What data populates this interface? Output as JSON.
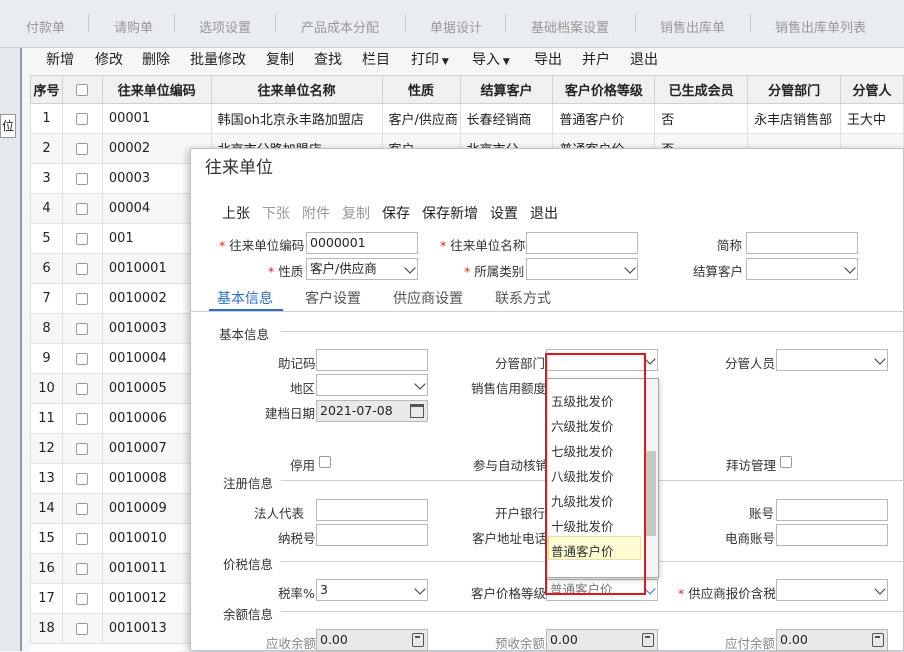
{
  "top_tabs": [
    "付款单",
    "请购单",
    "选项设置",
    "产品成本分配",
    "单据设计",
    "基础档案设置",
    "销售出库单",
    "销售出库单列表"
  ],
  "left_strip": {
    "label": "位"
  },
  "toolbar": [
    "新增",
    "修改",
    "删除",
    "批量修改",
    "复制",
    "查找",
    "栏目",
    "打印",
    "导入",
    "导出",
    "并户",
    "退出"
  ],
  "grid": {
    "columns": [
      "序号",
      "",
      "往来单位编码",
      "往来单位名称",
      "性质",
      "结算客户",
      "客户价格等级",
      "已生成会员",
      "分管部门",
      "分管人"
    ],
    "rows": [
      [
        "1",
        "",
        "00001",
        "韩国oh北京永丰路加盟店",
        "客户/供应商",
        "长春经销商",
        "普通客户价",
        "否",
        "永丰店销售部",
        "王大中"
      ],
      [
        "2",
        "",
        "00002",
        "北京市分路加盟店",
        "客户",
        "北京市分",
        "普通客户价",
        "否",
        "",
        ""
      ],
      [
        "3",
        "",
        "00003",
        "",
        "",
        "",
        "",
        "",
        "",
        ""
      ],
      [
        "4",
        "",
        "00004",
        "",
        "",
        "",
        "",
        "",
        "",
        ""
      ],
      [
        "5",
        "",
        "001",
        "",
        "",
        "",
        "",
        "",
        "",
        ""
      ],
      [
        "6",
        "",
        "0010001",
        "",
        "",
        "",
        "",
        "",
        "",
        ""
      ],
      [
        "7",
        "",
        "0010002",
        "",
        "",
        "",
        "",
        "",
        "",
        ""
      ],
      [
        "8",
        "",
        "0010003",
        "",
        "",
        "",
        "",
        "",
        "",
        ""
      ],
      [
        "9",
        "",
        "0010004",
        "",
        "",
        "",
        "",
        "",
        "",
        ""
      ],
      [
        "10",
        "",
        "0010005",
        "",
        "",
        "",
        "",
        "",
        "",
        ""
      ],
      [
        "11",
        "",
        "0010006",
        "",
        "",
        "",
        "",
        "",
        "",
        ""
      ],
      [
        "12",
        "",
        "0010007",
        "",
        "",
        "",
        "",
        "",
        "",
        ""
      ],
      [
        "13",
        "",
        "0010008",
        "",
        "",
        "",
        "",
        "",
        "",
        ""
      ],
      [
        "14",
        "",
        "0010009",
        "",
        "",
        "",
        "",
        "",
        "",
        ""
      ],
      [
        "15",
        "",
        "0010010",
        "",
        "",
        "",
        "",
        "",
        "",
        ""
      ],
      [
        "16",
        "",
        "0010011",
        "",
        "",
        "",
        "",
        "",
        "",
        ""
      ],
      [
        "17",
        "",
        "0010012",
        "",
        "",
        "",
        "",
        "",
        "",
        ""
      ],
      [
        "18",
        "",
        "0010013",
        "",
        "",
        "",
        "",
        "",
        "",
        ""
      ]
    ]
  },
  "modal": {
    "title": "往来单位",
    "actions": {
      "prev": "上张",
      "next": "下张",
      "attach": "附件",
      "copy": "复制",
      "save": "保存",
      "save_new": "保存新增",
      "settings": "设置",
      "exit": "退出"
    },
    "header": {
      "code_label": "往来单位编码",
      "code_value": "0000001",
      "name_label": "往来单位名称",
      "name_value": "",
      "short_label": "简称",
      "short_value": "",
      "type_label": "性质",
      "type_value": "客户/供应商",
      "category_label": "所属类别",
      "category_value": "",
      "settle_label": "结算客户",
      "settle_value": ""
    },
    "tabs": {
      "basic": "基本信息",
      "customer": "客户设置",
      "supplier": "供应商设置",
      "contact": "联系方式"
    },
    "basic": {
      "section_basic": "基本信息",
      "mnemonic_label": "助记码",
      "mnemonic_value": "",
      "dept_label": "分管部门",
      "dept_value": "",
      "staff_label": "分管人员",
      "staff_value": "",
      "region_label": "地区",
      "region_value": "",
      "credit_label": "销售信用额度",
      "date_label": "建档日期",
      "date_value": "2021-07-08",
      "disabled_label": "停用",
      "autoverify_label": "参与自动核销",
      "visit_label": "拜访管理",
      "section_reg": "注册信息",
      "legal_label": "法人代表",
      "legal_value": "",
      "bank_label": "开户银行",
      "account_label": "账号",
      "account_value": "",
      "tax_no_label": "纳税号",
      "tax_no_value": "",
      "address_label": "客户地址电话",
      "ecom_label": "电商账号",
      "ecom_value": "",
      "section_tax": "价税信息",
      "tax_rate_label": "税率%",
      "tax_rate_value": "3",
      "price_level_label": "客户价格等级",
      "price_level_value": "普通客户价",
      "supplier_tax_label": "供应商报价含税",
      "supplier_tax_value": "",
      "section_balance": "余额信息",
      "ar_label": "应收余额",
      "ar_value": "0.00",
      "prepaid_label": "预收余额",
      "prepaid_value": "0.00",
      "ap_label": "应付余额",
      "ap_value": "0.00"
    },
    "price_dropdown": {
      "options": [
        "五级批发价",
        "六级批发价",
        "七级批发价",
        "八级批发价",
        "九级批发价",
        "十级批发价",
        "普通客户价"
      ],
      "selected": "普通客户价"
    }
  },
  "colors": {
    "accent": "#2f6fc6",
    "highlight": "#e01818",
    "selected_row": "#fdfbd2"
  }
}
